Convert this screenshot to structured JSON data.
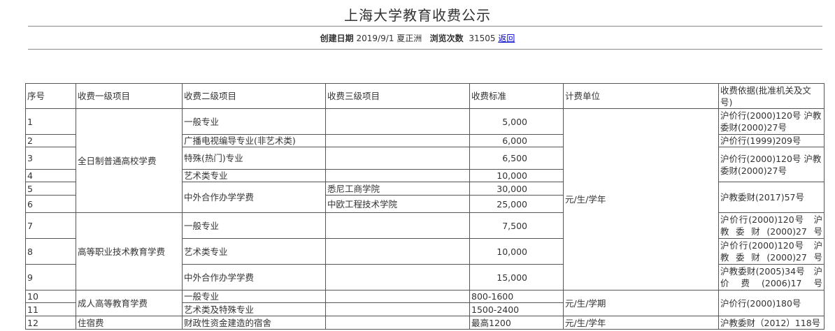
{
  "page": {
    "title": "上海大学教育收费公示",
    "created_label": "创建日期",
    "created_value": "2019/9/1 夏正洲",
    "views_label": "浏览次数",
    "views_value": "31505",
    "back_link": "返回"
  },
  "table": {
    "headers": [
      "序号",
      "收费一级项目",
      "收费二级项目",
      "收费三级项目",
      "收费标准",
      "计费单位",
      "收费依据(批准机关及文号)"
    ],
    "rows": [
      {
        "no": "1",
        "level1": "全日制普通高校学费",
        "level2": "一般专业",
        "level3": "",
        "standard": "5,000",
        "unit": "元/生/学年",
        "basis": "沪价行(2000)120号 沪教委财(2000)27号"
      },
      {
        "no": "2",
        "level2": "广播电视编导专业(非艺术类)",
        "level3": "",
        "standard": "6,000",
        "basis": "沪价行(1999)209号"
      },
      {
        "no": "3",
        "level2": "特殊(热门)专业",
        "level3": "",
        "standard": "6,500",
        "basis": "沪价行(2000)120号 沪教委财(2000)27号"
      },
      {
        "no": "4",
        "level2": "艺术类专业",
        "level3": "",
        "standard": "10,000"
      },
      {
        "no": "5",
        "level2": "中外合作办学学费",
        "level3": "悉尼工商学院",
        "standard": "30,000",
        "basis": "沪教委财(2017)57号"
      },
      {
        "no": "6",
        "level3": "中欧工程技术学院",
        "standard": "25,000"
      },
      {
        "no": "7",
        "level1": "高等职业技术教育学费",
        "level2": "一般专业",
        "level3": "",
        "standard": "7,500",
        "basis": "沪价行(2000)120号　沪教委财(2000)27号"
      },
      {
        "no": "8",
        "level2": "艺术类专业",
        "level3": "",
        "standard": "10,000",
        "basis": "沪价行(2000)120号　沪教委财(2000)27号"
      },
      {
        "no": "9",
        "level2": "中外合作办学学费",
        "level3": "",
        "standard": "15,000",
        "basis": "沪教委财(2005)34号　沪价费(2006)17号"
      },
      {
        "no": "10",
        "level1": "成人高等教育学费",
        "level2": "一般专业",
        "level3": "",
        "standard": "800-1600",
        "unit": "元/生/学期",
        "basis": "沪价行(2000)180号"
      },
      {
        "no": "11",
        "level2": "艺术类及特殊专业",
        "level3": "",
        "standard": "1500-2400"
      },
      {
        "no": "12",
        "level1": "住宿费",
        "level2": "财政性资金建造的宿舍",
        "level3": "",
        "standard": "最高1200",
        "unit": "元/生/学年",
        "basis": "沪教委财（2012）118号"
      }
    ]
  }
}
